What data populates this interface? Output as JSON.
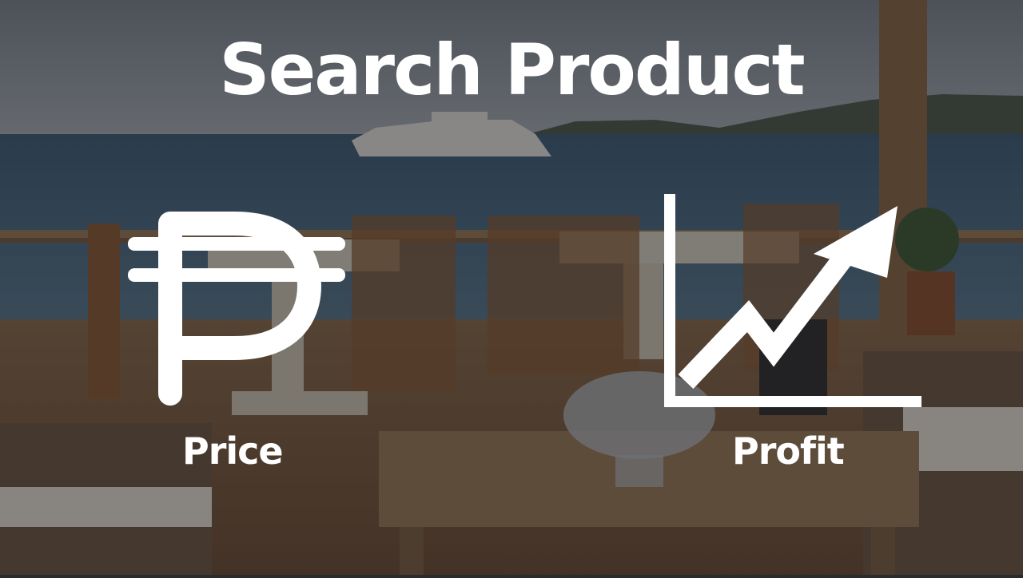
{
  "slide": {
    "title": "Search Product",
    "items": [
      {
        "label": "Price",
        "icon": "peso-sign-icon"
      },
      {
        "label": "Profit",
        "icon": "trending-up-chart-icon"
      }
    ]
  },
  "colors": {
    "text": "#ffffff",
    "overlay": "rgba(20,20,24,0.45)"
  }
}
